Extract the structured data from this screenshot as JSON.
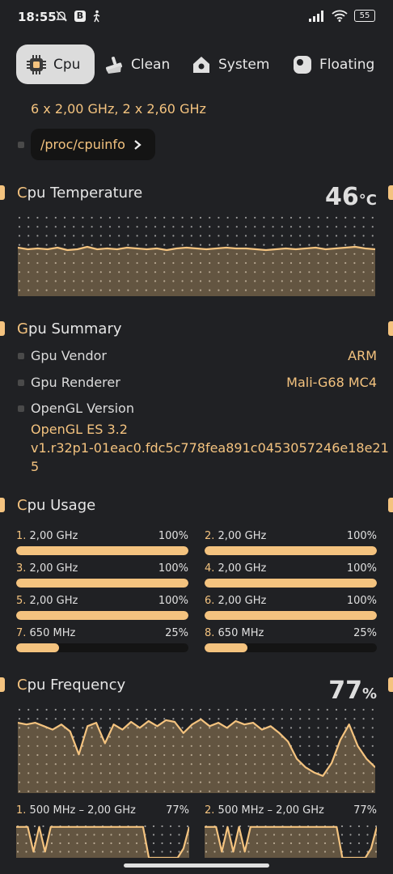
{
  "status_bar": {
    "time": "18:55",
    "b_badge": "B",
    "battery": "55",
    "icons": [
      "bell-off-icon",
      "b-badge-icon",
      "walking-icon",
      "signal-icon",
      "wifi-icon",
      "battery-icon"
    ]
  },
  "tabs": [
    {
      "label": "Cpu",
      "icon": "chip-icon",
      "active": true
    },
    {
      "label": "Clean",
      "icon": "broom-icon",
      "active": false
    },
    {
      "label": "System",
      "icon": "home-icon",
      "active": false
    },
    {
      "label": "Floating",
      "icon": "floating-icon",
      "active": false
    }
  ],
  "cpu_info": {
    "summary": "6 x 2,00 GHz, 2 x 2,60 GHz",
    "proc_button": "/proc/cpuinfo"
  },
  "cpu_temperature": {
    "title_first": "C",
    "title_rest": "pu Temperature",
    "value": "46",
    "unit": "°C",
    "series": [
      60,
      58,
      59,
      58,
      60,
      57,
      58,
      61,
      58,
      59,
      58,
      60,
      59,
      58,
      59,
      57,
      59,
      60,
      59,
      58,
      59,
      60,
      59,
      59,
      58,
      57,
      58,
      59,
      58,
      59,
      60,
      58,
      59,
      60,
      61,
      59,
      58
    ]
  },
  "gpu_summary": {
    "title_first": "G",
    "title_rest": "pu Summary",
    "vendor_label": "Gpu Vendor",
    "vendor_value": "ARM",
    "renderer_label": "Gpu Renderer",
    "renderer_value": "Mali-G68 MC4",
    "opengl_label": "OpenGL Version",
    "opengl_line1": "OpenGL ES 3.2",
    "opengl_line2": "v1.r32p1-01eac0.fdc5c778fea891c0453057246e18e21",
    "opengl_line3": "5"
  },
  "cpu_usage": {
    "title_first": "C",
    "title_rest": "pu Usage",
    "cores": [
      {
        "n": "1.",
        "freq": "2,00 GHz",
        "pct": "100%",
        "level": 1.0
      },
      {
        "n": "2.",
        "freq": "2,00 GHz",
        "pct": "100%",
        "level": 1.0
      },
      {
        "n": "3.",
        "freq": "2,00 GHz",
        "pct": "100%",
        "level": 1.0
      },
      {
        "n": "4.",
        "freq": "2,00 GHz",
        "pct": "100%",
        "level": 1.0
      },
      {
        "n": "5.",
        "freq": "2,00 GHz",
        "pct": "100%",
        "level": 1.0
      },
      {
        "n": "6.",
        "freq": "2,00 GHz",
        "pct": "100%",
        "level": 1.0
      },
      {
        "n": "7.",
        "freq": "650 MHz",
        "pct": "25%",
        "level": 0.25
      },
      {
        "n": "8.",
        "freq": "650 MHz",
        "pct": "25%",
        "level": 0.25
      }
    ]
  },
  "cpu_frequency": {
    "title_first": "C",
    "title_rest": "pu Frequency",
    "value": "77",
    "unit": "%",
    "series": [
      82,
      80,
      82,
      78,
      74,
      80,
      72,
      45,
      78,
      82,
      58,
      80,
      74,
      83,
      76,
      84,
      78,
      85,
      83,
      70,
      80,
      86,
      78,
      82,
      76,
      84,
      80,
      82,
      74,
      78,
      70,
      60,
      40,
      30,
      24,
      20,
      35,
      62,
      80,
      55,
      40,
      30
    ],
    "cores": [
      {
        "n": "1.",
        "range": "500 MHz – 2,00 GHz",
        "pct": "77%",
        "series": [
          100,
          100,
          100,
          20,
          100,
          20,
          100,
          100,
          100,
          100,
          100,
          100,
          100,
          100,
          100,
          100,
          100,
          100,
          100,
          100,
          100,
          100,
          100,
          0,
          0,
          0,
          0,
          0,
          0,
          30,
          100
        ]
      },
      {
        "n": "2.",
        "range": "500 MHz – 2,00 GHz",
        "pct": "77%",
        "series": [
          100,
          100,
          100,
          20,
          100,
          20,
          100,
          20,
          100,
          100,
          100,
          100,
          100,
          100,
          100,
          100,
          100,
          100,
          100,
          100,
          100,
          100,
          100,
          100,
          0,
          0,
          0,
          0,
          0,
          30,
          100
        ]
      }
    ]
  }
}
